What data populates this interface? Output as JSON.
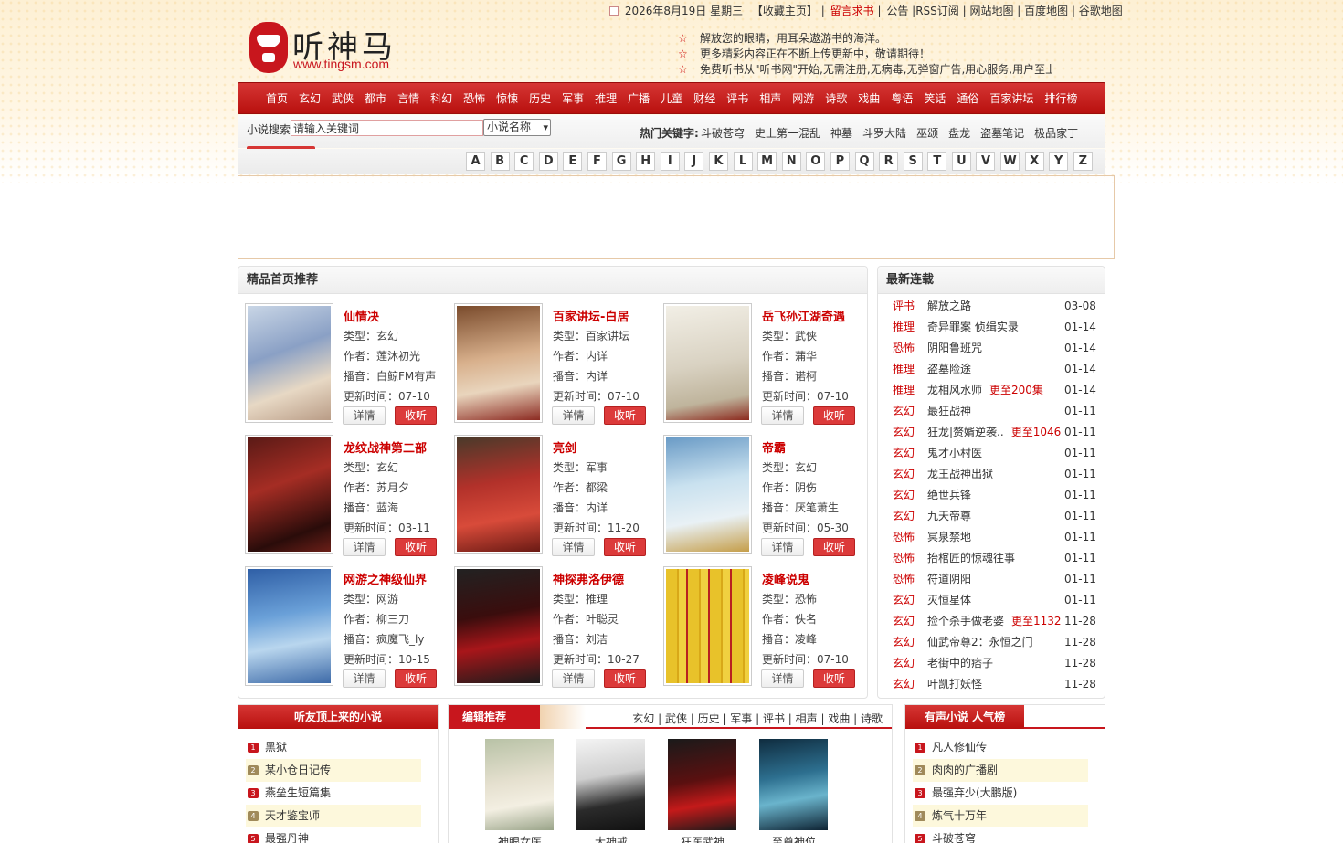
{
  "topbar": {
    "date": "2026年8月19日 星期三",
    "fav": "【收藏主页】",
    "sep": "|",
    "guestbook": "留言求书",
    "links": "公告 |RSS订阅 | 网站地图 | 百度地图 | 谷歌地图"
  },
  "logo": {
    "name": "听神马",
    "url": "www.tingsm.com"
  },
  "notice": [
    "解放您的眼睛，用耳朵遨游书的海洋。",
    "更多精彩内容正在不断上传更新中，敬请期待！",
    "免费听书从\"听书网\"开始,无需注册,无病毒,无弹窗广告,用心服务,用户至上"
  ],
  "nav": [
    "首页",
    "玄幻",
    "武侠",
    "都市",
    "言情",
    "科幻",
    "恐怖",
    "惊悚",
    "历史",
    "军事",
    "推理",
    "广播",
    "儿童",
    "财经",
    "评书",
    "相声",
    "网游",
    "诗歌",
    "戏曲",
    "粤语",
    "笑话",
    "通俗",
    "百家讲坛",
    "排行榜"
  ],
  "search": {
    "label": "小说搜索",
    "value": "请输入关键词",
    "select": "小说名称",
    "hot_label": "热门关键字:",
    "hot": [
      "斗破苍穹",
      "史上第一混乱",
      "神墓",
      "斗罗大陆",
      "巫颂",
      "盘龙",
      "盗墓笔记",
      "极品家丁"
    ]
  },
  "letters": [
    "A",
    "B",
    "C",
    "D",
    "E",
    "F",
    "G",
    "H",
    "I",
    "J",
    "K",
    "L",
    "M",
    "N",
    "O",
    "P",
    "Q",
    "R",
    "S",
    "T",
    "U",
    "V",
    "W",
    "X",
    "Y",
    "Z"
  ],
  "recommend": {
    "title": "精品首页推荐",
    "detail_label": "详情",
    "listen_label": "收听",
    "items": [
      {
        "name": "仙情决",
        "type": "类型：玄幻",
        "author": "作者：莲沐初光",
        "narrator": "播音：白鲸FM有声",
        "updated": "更新时间：07-10",
        "cover": "linear-gradient(160deg,#c9d6e6,#8aa0c5 40%,#e7d8c4 70%,#b99c86)"
      },
      {
        "name": "百家讲坛-白居",
        "type": "类型：百家讲坛",
        "author": "作者：内详",
        "narrator": "播音：内详",
        "updated": "更新时间：07-10",
        "cover": "linear-gradient(170deg,#7a4b2c,#d8b08c 45%,#e9d5bd 70%,#8c2b22)"
      },
      {
        "name": "岳飞孙江湖奇遇",
        "type": "类型：武侠",
        "author": "作者：蒲华",
        "narrator": "播音：诺柯",
        "updated": "更新时间：07-10",
        "cover": "linear-gradient(170deg,#f2efe6,#d9d2c2 50%,#bfb49c 80%,#8c2a1e)"
      },
      {
        "name": "龙纹战神第二部",
        "type": "类型：玄幻",
        "author": "作者：苏月夕",
        "narrator": "播音：蓝海",
        "updated": "更新时间：03-11",
        "cover": "linear-gradient(160deg,#5a1a16,#a52d24 40%,#2a0c0a 80%,#6b1f18)"
      },
      {
        "name": "亮剑",
        "type": "类型：军事",
        "author": "作者：都梁",
        "narrator": "播音：内详",
        "updated": "更新时间：11-20",
        "cover": "linear-gradient(170deg,#4a3a2a,#b2312a 40%,#d84b3a 70%,#6a1a14)"
      },
      {
        "name": "帝霸",
        "type": "类型：玄幻",
        "author": "作者：阴伤",
        "narrator": "播音：厌笔萧生",
        "updated": "更新时间：05-30",
        "cover": "linear-gradient(170deg,#6a9bc6,#c9e1ef 40%,#e9f1f5 70%,#c59e4a)"
      },
      {
        "name": "网游之神级仙界",
        "type": "类型：网游",
        "author": "作者：柳三刀",
        "narrator": "播音：疯魔飞_ly",
        "updated": "更新时间：10-15",
        "cover": "linear-gradient(170deg,#2f5fa6,#6aa0d8 40%,#b9d6ee 65%,#3d6aa8)"
      },
      {
        "name": "神探弗洛伊德",
        "type": "类型：推理",
        "author": "作者：叶聪灵",
        "narrator": "播音：刘洁",
        "updated": "更新时间：10-27",
        "cover": "linear-gradient(170deg,#222,#3a0d0d 40%,#a8161a 65%,#1b1b1b)"
      },
      {
        "name": "凌峰说鬼",
        "type": "类型：恐怖",
        "author": "作者：佚名",
        "narrator": "播音：凌峰",
        "updated": "更新时间：07-10",
        "cover": "repeating-linear-gradient(90deg,#e8c22a 0 12px,#d8a818 12px 14px,#f0d040 14px 22px,#b82020 22px 24px)"
      }
    ]
  },
  "latest": {
    "title": "最新连载",
    "items": [
      {
        "cat": "评书",
        "title": "解放之路",
        "update": "",
        "date": "03-08"
      },
      {
        "cat": "推理",
        "title": "奇异罪案 侦缉实录",
        "update": "",
        "date": "01-14"
      },
      {
        "cat": "恐怖",
        "title": "阴阳鲁班咒",
        "update": "",
        "date": "01-14"
      },
      {
        "cat": "推理",
        "title": "盗墓险途",
        "update": "",
        "date": "01-14"
      },
      {
        "cat": "推理",
        "title": "龙相风水师",
        "update": "更至200集",
        "date": "01-14"
      },
      {
        "cat": "玄幻",
        "title": "最狂战神",
        "update": "",
        "date": "01-11"
      },
      {
        "cat": "玄幻",
        "title": "狂龙|赘婿逆袭..",
        "update": "更至1046",
        "date": "01-11"
      },
      {
        "cat": "玄幻",
        "title": "鬼才小村医",
        "update": "",
        "date": "01-11"
      },
      {
        "cat": "玄幻",
        "title": "龙王战神出狱",
        "update": "",
        "date": "01-11"
      },
      {
        "cat": "玄幻",
        "title": "绝世兵锋",
        "update": "",
        "date": "01-11"
      },
      {
        "cat": "玄幻",
        "title": "九天帝尊",
        "update": "",
        "date": "01-11"
      },
      {
        "cat": "恐怖",
        "title": "冥泉禁地",
        "update": "",
        "date": "01-11"
      },
      {
        "cat": "恐怖",
        "title": "抬棺匠的惊魂往事",
        "update": "",
        "date": "01-11"
      },
      {
        "cat": "恐怖",
        "title": "符道阴阳",
        "update": "",
        "date": "01-11"
      },
      {
        "cat": "玄幻",
        "title": "灭恒星体",
        "update": "",
        "date": "01-11"
      },
      {
        "cat": "玄幻",
        "title": "捡个杀手做老婆",
        "update": "更至1132",
        "date": "11-28"
      },
      {
        "cat": "玄幻",
        "title": "仙武帝尊2：永恒之门",
        "update": "",
        "date": "11-28"
      },
      {
        "cat": "玄幻",
        "title": "老街中的痞子",
        "update": "",
        "date": "11-28"
      },
      {
        "cat": "玄幻",
        "title": "叶凯打妖怪",
        "update": "",
        "date": "11-28"
      }
    ]
  },
  "toplist": {
    "title": "听友顶上来的小说",
    "items": [
      "黑狱",
      "某小仓日记传",
      "燕垒生短篇集",
      "天才鉴宝师",
      "最强丹神"
    ]
  },
  "editor": {
    "title": "编辑推荐",
    "cats": "玄幻 | 武侠 | 历史 | 军事 | 评书 | 相声 | 戏曲 | 诗歌",
    "books": [
      {
        "name": "神眼女医",
        "cover": "linear-gradient(170deg,#b8c2a6,#e5e0cf 45%,#f3efe2 70%,#9aa489)"
      },
      {
        "name": "大神戒",
        "cover": "linear-gradient(170deg,#f4f4f4,#cfcfcf 40%,#2b2b2b 70%,#111)"
      },
      {
        "name": "狂医武神",
        "cover": "linear-gradient(170deg,#1a1a1a,#5a1010 45%,#c41a1a 70%,#1a1a1a)"
      },
      {
        "name": "至尊神位",
        "cover": "linear-gradient(170deg,#0f2c3f,#2d6f8f 40%,#6ab4cc 65%,#0e2333)"
      }
    ]
  },
  "popular": {
    "title": "有声小说 人气榜",
    "items": [
      "凡人修仙传",
      "肉肉的广播剧",
      "最强弃少(大鹏版)",
      "炼气十万年",
      "斗破苍穹"
    ]
  }
}
